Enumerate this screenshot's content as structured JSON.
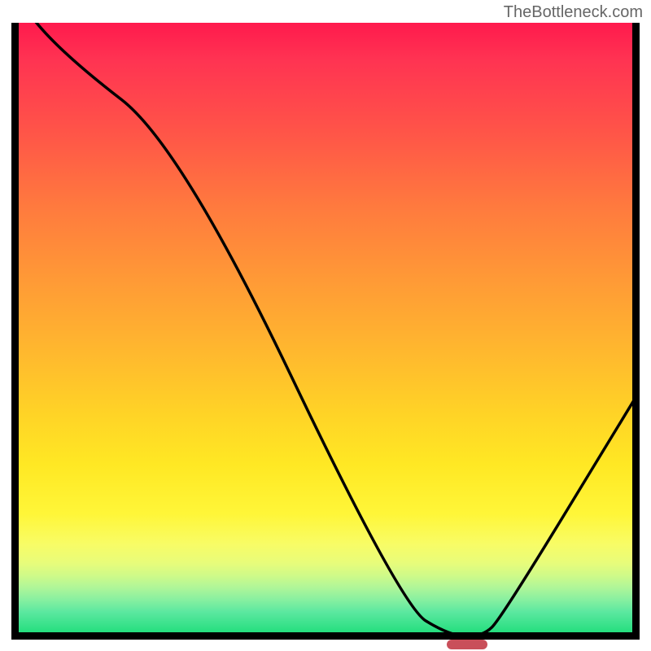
{
  "watermark": "TheBottleneck.com",
  "chart_data": {
    "type": "line",
    "title": "",
    "xlabel": "",
    "ylabel": "",
    "xlim": [
      0,
      100
    ],
    "ylim": [
      0,
      100
    ],
    "series": [
      {
        "name": "bottleneck-curve",
        "x": [
          0,
          8,
          27,
          62,
          70,
          75,
          78,
          100
        ],
        "values": [
          105,
          95,
          80,
          5,
          0,
          0,
          3,
          40
        ]
      }
    ],
    "marker": {
      "name": "optimal-zone",
      "x_center": 72.5,
      "y": 0,
      "width_pct": 6.5,
      "color": "#c94f5a"
    },
    "gradient_scale": {
      "description": "vertical background gradient, red(top)=high bottleneck, green(bottom)=low bottleneck",
      "stops": [
        {
          "pct": 0,
          "color": "#ff1a4d"
        },
        {
          "pct": 50,
          "color": "#ffb92e"
        },
        {
          "pct": 80,
          "color": "#fff638"
        },
        {
          "pct": 100,
          "color": "#1adc78"
        }
      ]
    }
  }
}
